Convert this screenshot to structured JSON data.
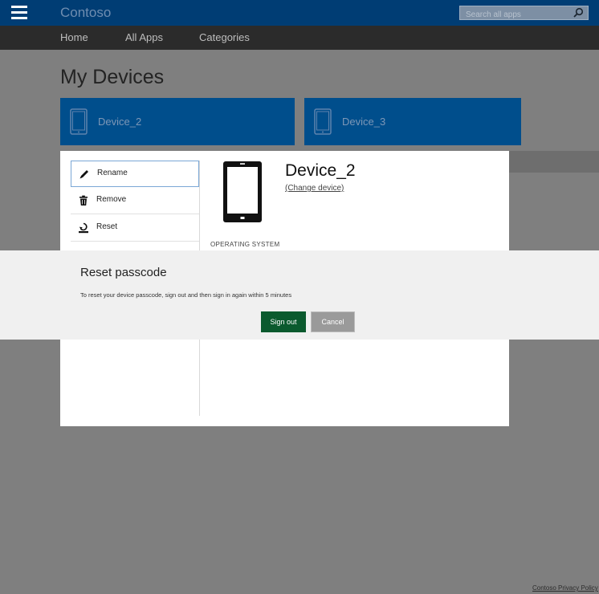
{
  "header": {
    "brand": "Contoso",
    "search_placeholder": "Search all apps"
  },
  "nav": {
    "items": [
      {
        "label": "Home"
      },
      {
        "label": "All Apps"
      },
      {
        "label": "Categories"
      }
    ]
  },
  "page": {
    "title": "My Devices"
  },
  "devices": [
    {
      "label": "Device_2"
    },
    {
      "label": "Device_3"
    }
  ],
  "device_panel": {
    "menu": [
      {
        "label": "Rename",
        "icon": "pencil-icon"
      },
      {
        "label": "Remove",
        "icon": "trash-icon"
      },
      {
        "label": "Reset",
        "icon": "reset-icon"
      }
    ],
    "device_name": "Device_2",
    "change_link": "(Change device)",
    "section_label": "OPERATING SYSTEM"
  },
  "modal": {
    "title": "Reset passcode",
    "message": "To reset your device passcode, sign out and then sign in again within 5 minutes",
    "primary_label": "Sign out",
    "secondary_label": "Cancel"
  },
  "footer": {
    "link": "Contoso Privacy Policy"
  },
  "colors": {
    "header_bg": "#003d74",
    "nav_bg": "#2b2b2b",
    "tile_bg": "#004e8c",
    "primary_button": "#0b5a2e",
    "overlay": "#7f7f7f"
  }
}
